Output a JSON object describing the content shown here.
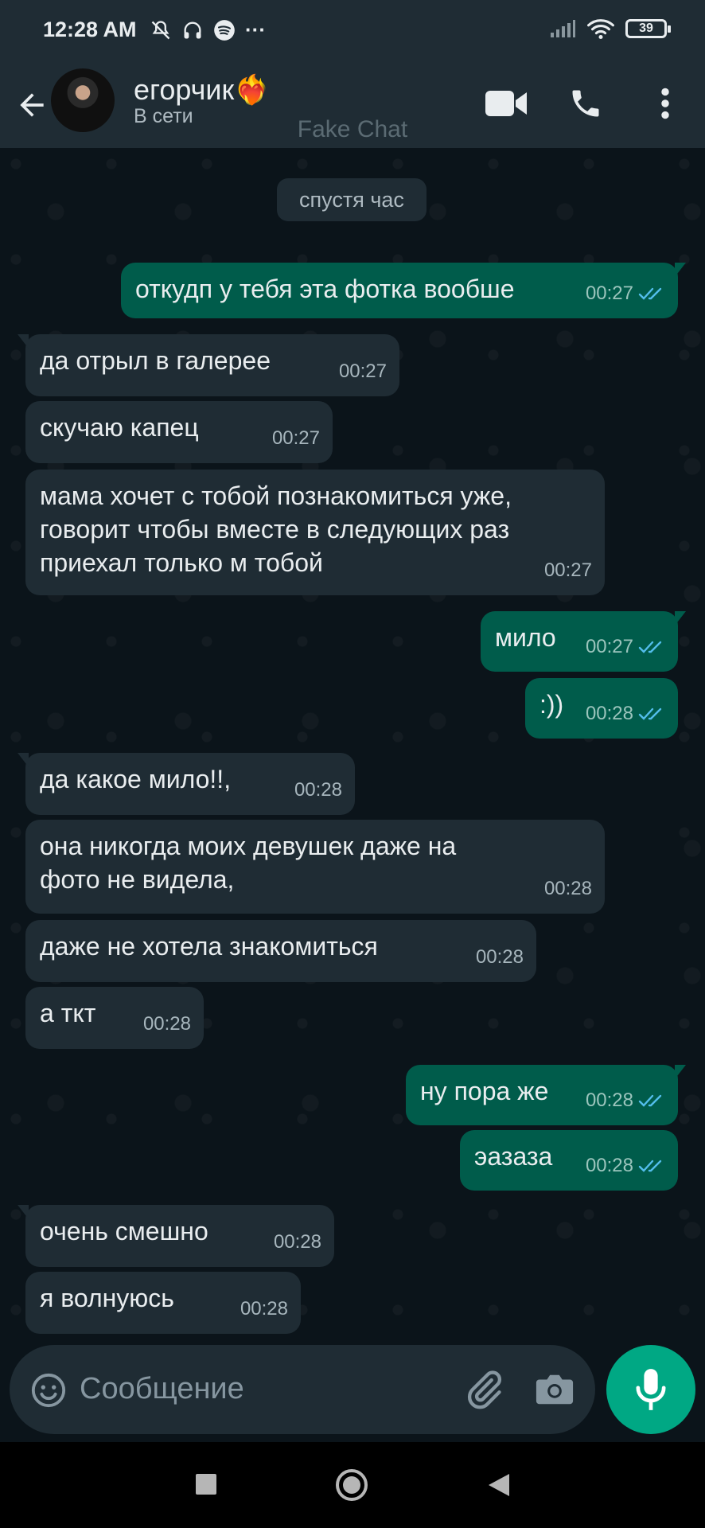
{
  "status": {
    "time": "12:28 AM",
    "ellipsis": "···",
    "battery": "39"
  },
  "header": {
    "contact_name": "егорчик❤️‍🔥",
    "contact_status": "В сети",
    "watermark": "Fake Chat"
  },
  "chat": {
    "date_chip": "спустя час",
    "messages": [
      {
        "text": "откудп у тебя эта фотка вообше",
        "time": "00:27"
      },
      {
        "text": "да отрыл в галерее",
        "time": "00:27"
      },
      {
        "text": "скучаю капец",
        "time": "00:27"
      },
      {
        "text_lines": [
          "мама хочет с тобой познакомиться уже,",
          "говорит чтобы вместе в следующих раз",
          "приехал только м тобой"
        ],
        "time": "00:27"
      },
      {
        "text": "мило",
        "time": "00:27"
      },
      {
        "text": ":))",
        "time": "00:28"
      },
      {
        "text": "да какое мило!!,",
        "time": "00:28"
      },
      {
        "text_lines": [
          "она никогда моих девушек даже на",
          "фото не видела,"
        ],
        "time": "00:28"
      },
      {
        "text": "даже не хотела знакомиться",
        "time": "00:28"
      },
      {
        "text": "а ткт",
        "time": "00:28"
      },
      {
        "text": "ну пора же",
        "time": "00:28"
      },
      {
        "text": "эазаза",
        "time": "00:28"
      },
      {
        "text": "очень смешно",
        "time": "00:28"
      },
      {
        "text": "я волнуюсь",
        "time": "00:28"
      }
    ]
  },
  "composer": {
    "placeholder": "Сообщение"
  },
  "colors": {
    "background": "#0b141a",
    "header": "#1f2c34",
    "incoming_bubble": "#1f2c34",
    "outgoing_bubble": "#005c4b",
    "accent": "#00a884",
    "read_ticks": "#53bdeb"
  }
}
